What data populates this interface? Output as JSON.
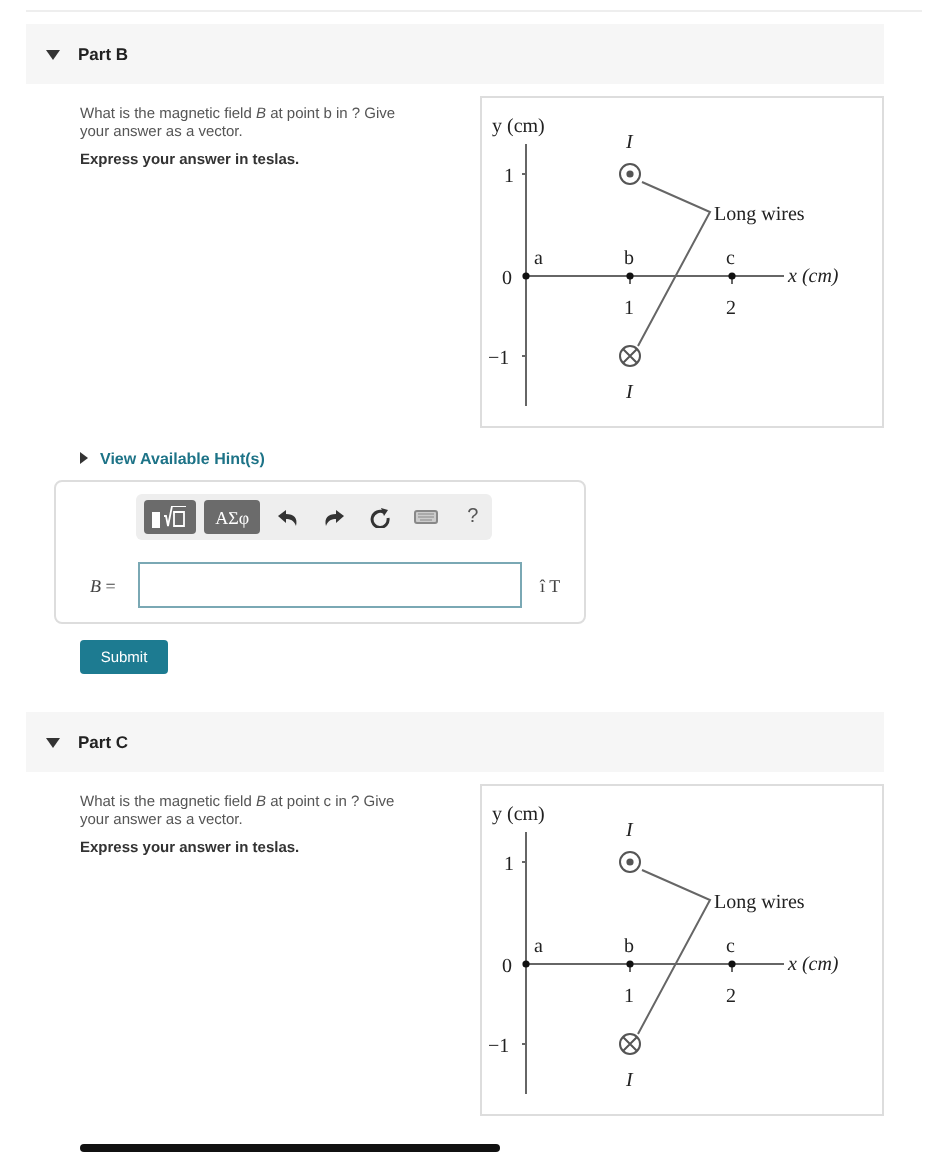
{
  "parts": [
    {
      "title": "Part B",
      "expanded": true,
      "question": "What is the magnetic field *B* at point b in ? Give your answer as a vector.",
      "instruction": "Express your answer in teslas.",
      "figure": {
        "y_axis_label": "y (cm)",
        "x_axis_label": "x (cm)",
        "y_ticks": [
          "1",
          "0",
          "−1"
        ],
        "x_ticks": [
          "1",
          "2"
        ],
        "points": [
          "a",
          "b",
          "c"
        ],
        "current_labels": [
          "I",
          "I"
        ],
        "callout": "Long wires"
      },
      "hint_link": "View Available Hint(s)",
      "answer": {
        "toolbar": {
          "symbols_button": "ΑΣφ",
          "help_button": "?"
        },
        "label": "*B* =",
        "unit": "î T"
      },
      "submit": "Submit"
    },
    {
      "title": "Part C",
      "expanded": true,
      "question": "What is the magnetic field *B* at point c in ? Give your answer as a vector.",
      "instruction": "Express your answer in teslas.",
      "figure": {
        "y_axis_label": "y (cm)",
        "x_axis_label": "x (cm)",
        "y_ticks": [
          "1",
          "0",
          "−1"
        ],
        "x_ticks": [
          "1",
          "2"
        ],
        "points": [
          "a",
          "b",
          "c"
        ],
        "current_labels": [
          "I",
          "I"
        ],
        "callout": "Long wires"
      }
    }
  ]
}
